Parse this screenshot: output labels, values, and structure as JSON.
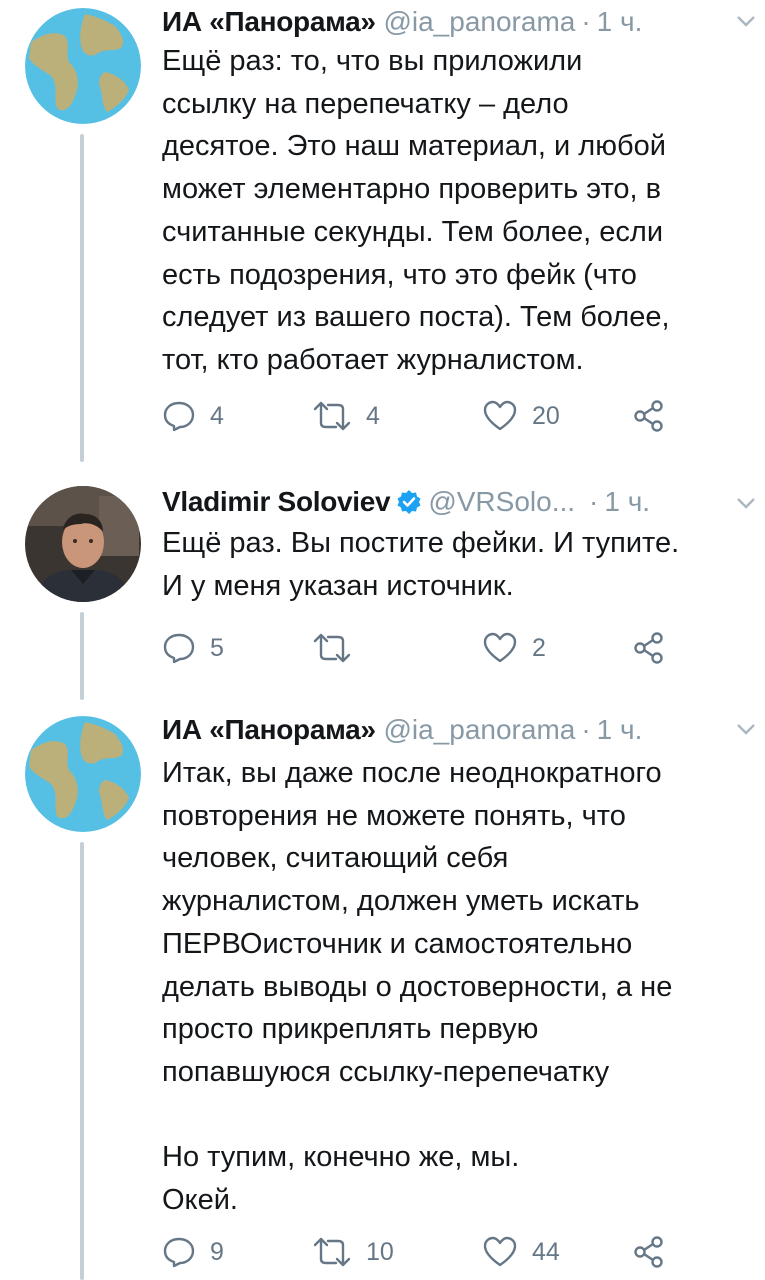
{
  "tweets": [
    {
      "name": "ИА «Панорама»",
      "handle": "@ia_panorama",
      "time": "1 ч.",
      "verified": false,
      "avatar": "globe",
      "text": "Ещё раз: то, что вы приложили\nссылку на перепечатку – дело\nдесятое. Это наш материал, и любой\nможет элементарно проверить это, в\nсчитанные секунды. Тем более, если\nесть подозрения, что это фейк (что\nследует из вашего поста). Тем более,\nтот, кто работает журналистом.",
      "replies": "4",
      "retweets": "4",
      "likes": "20"
    },
    {
      "name": "Vladimir Soloviev",
      "handle": "@VRSolo...",
      "time": "1 ч.",
      "verified": true,
      "avatar": "person-photo",
      "text": "Ещё раз. Вы постите фейки. И тупите.\nИ у меня указан источник.",
      "replies": "5",
      "retweets": "",
      "likes": "2"
    },
    {
      "name": "ИА «Панорама»",
      "handle": "@ia_panorama",
      "time": "1 ч.",
      "verified": false,
      "avatar": "globe",
      "text": "Итак, вы даже после неоднократного\nповторения не можете понять, что\nчеловек, считающий себя\nжурналистом, должен уметь искать\nПЕРВОисточник и самостоятельно\nделать выводы о достоверности, а не\nпросто прикреплять первую\nпопавшуюся ссылку-перепечатку\n\nНо тупим, конечно же, мы.\nОкей.",
      "replies": "9",
      "retweets": "10",
      "likes": "44"
    }
  ],
  "colors": {
    "text": "#14171a",
    "secondary": "#8899a6",
    "action": "#657786",
    "verified": "#1da1f2",
    "thread_line": "#c4cfd6",
    "globe_ocean": "#55bfe4",
    "globe_land": "#bcb07a"
  }
}
